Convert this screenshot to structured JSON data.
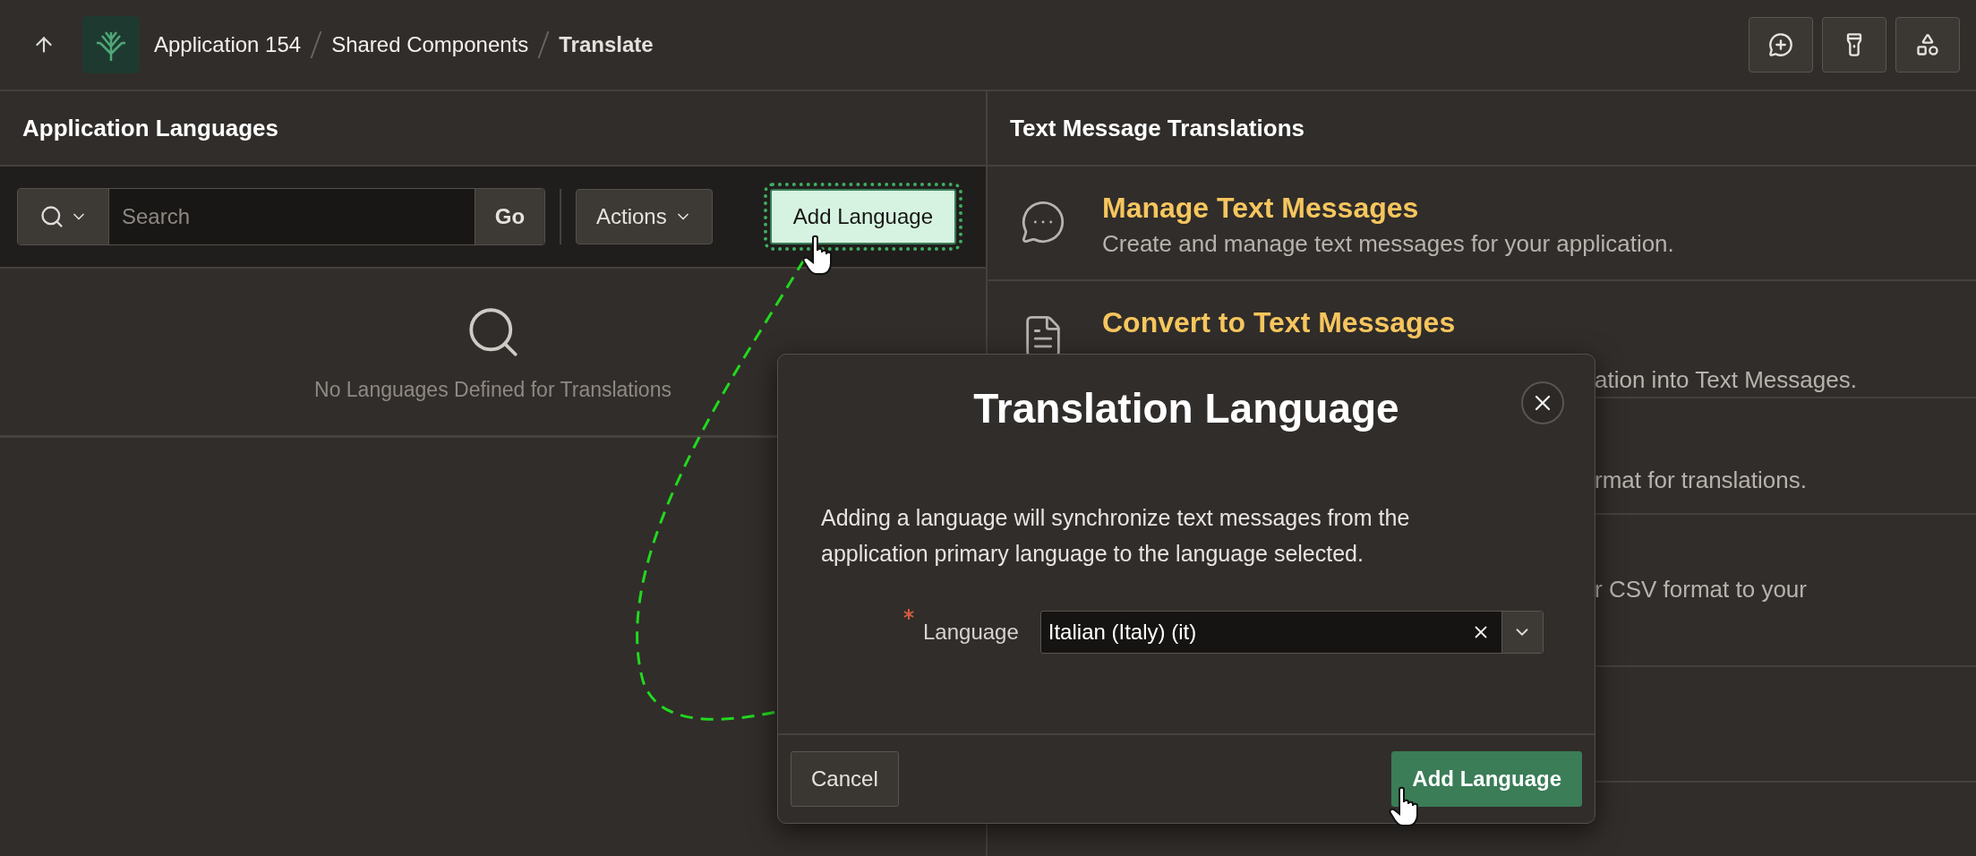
{
  "top_bar": {
    "breadcrumbs": [
      {
        "label": "Application 154",
        "current": false
      },
      {
        "label": "Shared Components",
        "current": false
      },
      {
        "label": "Translate",
        "current": true
      }
    ]
  },
  "left_panel": {
    "title": "Application Languages",
    "search": {
      "placeholder": "Search"
    },
    "go_button": "Go",
    "actions_button": "Actions",
    "add_button": {
      "label": "Add Language",
      "highlighted": true
    },
    "empty_message": "No Languages Defined for Translations"
  },
  "right_panel": {
    "title": "Text Message Translations",
    "items": [
      {
        "kind": "full",
        "title": "Manage Text Messages",
        "description": "Create and manage text messages for your application."
      },
      {
        "kind": "covered",
        "title": "Convert to Text Messages",
        "fragment": "ation into Text Messages."
      },
      {
        "kind": "covered",
        "fragment": "rmat for translations."
      },
      {
        "kind": "covered",
        "fragment": "r CSV format to your"
      },
      {
        "kind": "covered"
      },
      {
        "kind": "covered"
      }
    ]
  },
  "dialog": {
    "title": "Translation Language",
    "message": "Adding a language will synchronize text messages from the application primary language to the language selected.",
    "field": {
      "label": "Language",
      "required": true,
      "value": "Italian (Italy) (it)"
    },
    "buttons": [
      {
        "label": "Cancel",
        "kind": "secondary"
      },
      {
        "label": "Add Language",
        "kind": "primary"
      }
    ]
  }
}
